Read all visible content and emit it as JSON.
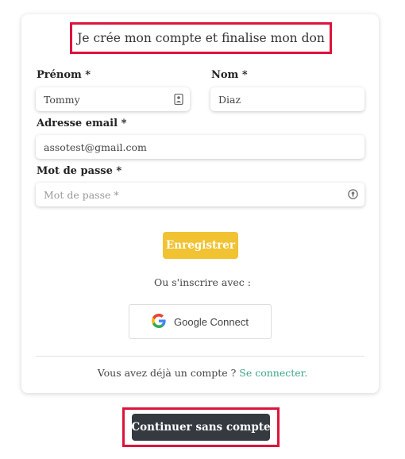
{
  "form": {
    "title": "Je crée mon compte et finalise mon don",
    "first_name_label": "Prénom *",
    "first_name_value": "Tommy",
    "last_name_label": "Nom *",
    "last_name_value": "Diaz",
    "email_label": "Adresse email *",
    "email_value": "assotest@gmail.com",
    "password_label": "Mot de passe *",
    "password_placeholder": "Mot de passe *",
    "register_button": "Enregistrer",
    "or_text": "Ou s'inscrire avec :",
    "google_button": "Google Connect",
    "have_account_text": "Vous avez déjà un compte ?",
    "login_link": "Se connecter."
  },
  "footer": {
    "continue_button": "Continuer sans compte"
  },
  "colors": {
    "accent_yellow": "#f1c232",
    "link_green": "#3aa687",
    "highlight_red": "#dc143c",
    "dark_button": "#353a40"
  },
  "icons": {
    "first_name_field": "contact-card-icon",
    "password_field": "password-manager-icon",
    "google": "google-logo-icon"
  }
}
